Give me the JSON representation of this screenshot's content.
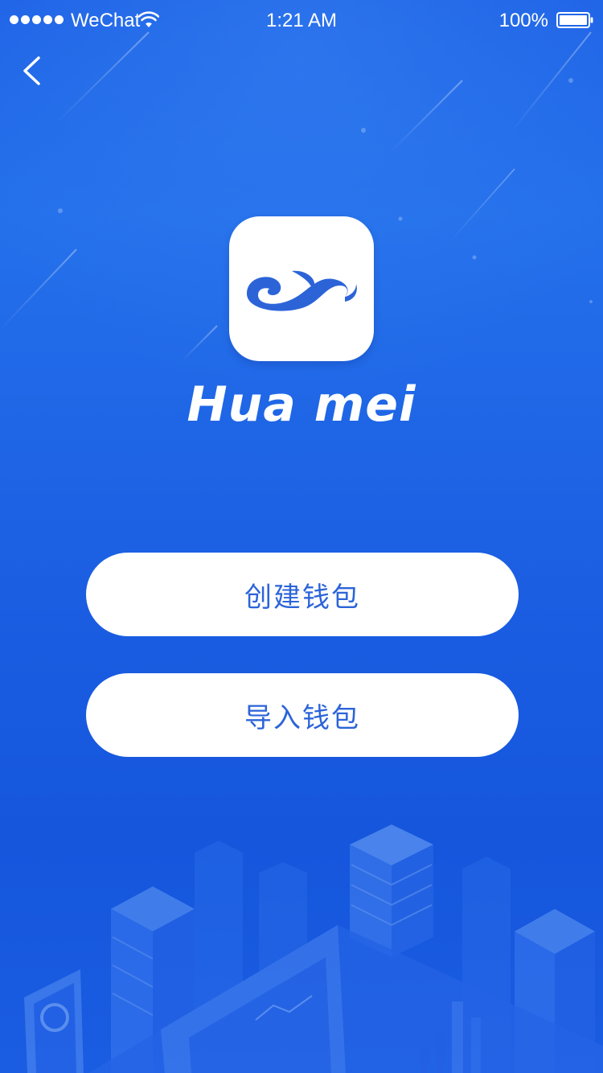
{
  "status_bar": {
    "carrier": "WeChat",
    "time": "1:21 AM",
    "battery": "100%"
  },
  "nav": {
    "back_icon": "chevron-left-icon"
  },
  "app": {
    "logo_icon": "wave-logo-icon",
    "name": "Hua mei"
  },
  "actions": {
    "create_wallet": "创建钱包",
    "import_wallet": "导入钱包"
  },
  "colors": {
    "background": "#1f63e6",
    "button_text": "#2c64d8",
    "button_bg": "#ffffff"
  }
}
